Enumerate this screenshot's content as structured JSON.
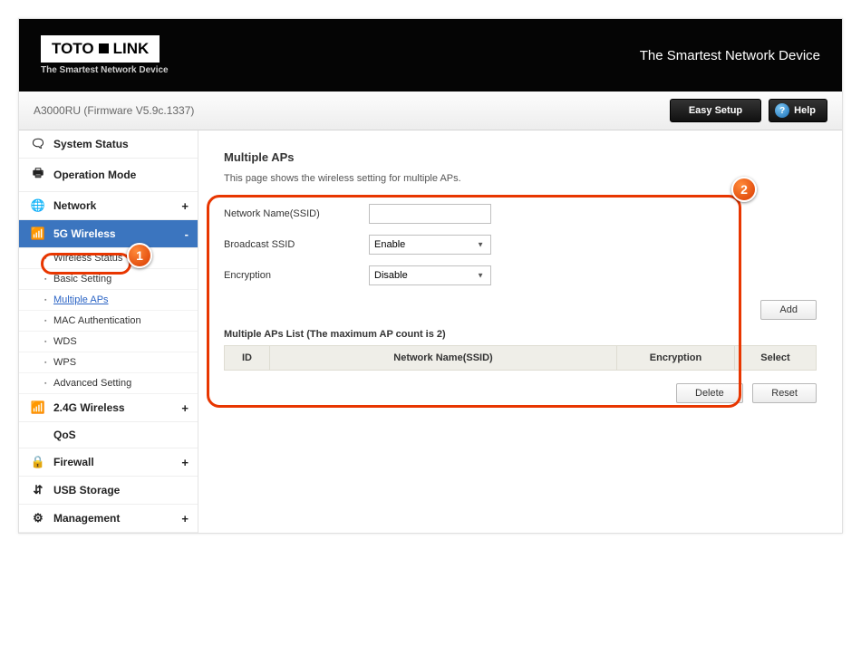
{
  "header": {
    "logo_text1": "TOTO",
    "logo_text2": "LINK",
    "tagline_small": "The Smartest Network Device",
    "tagline_big": "The Smartest Network Device"
  },
  "subheader": {
    "model": "A3000RU (Firmware V5.9c.1337)",
    "easy_setup": "Easy Setup",
    "help": "Help",
    "help_icon_glyph": "?"
  },
  "sidebar": {
    "items": [
      {
        "label": "System Status",
        "icon": "🗨",
        "toggle": ""
      },
      {
        "label": "Operation Mode",
        "icon": "🖶",
        "toggle": ""
      },
      {
        "label": "Network",
        "icon": "🌐",
        "toggle": "+"
      },
      {
        "label": "5G Wireless",
        "icon": "📶",
        "toggle": "-",
        "active": true
      },
      {
        "label": "2.4G Wireless",
        "icon": "📶",
        "toggle": "+"
      },
      {
        "label": "QoS",
        "icon": "",
        "toggle": ""
      },
      {
        "label": "Firewall",
        "icon": "🔒",
        "toggle": "+"
      },
      {
        "label": "USB Storage",
        "icon": "⇵",
        "toggle": ""
      },
      {
        "label": "Management",
        "icon": "⚙",
        "toggle": "+"
      }
    ],
    "sub_5g": [
      {
        "label": "Wireless Status"
      },
      {
        "label": "Basic Setting"
      },
      {
        "label": "Multiple APs",
        "highlight": true
      },
      {
        "label": "MAC Authentication"
      },
      {
        "label": "WDS"
      },
      {
        "label": "WPS"
      },
      {
        "label": "Advanced Setting"
      }
    ]
  },
  "main": {
    "title": "Multiple APs",
    "desc": "This page shows the wireless setting for multiple APs.",
    "form": {
      "ssid_label": "Network Name(SSID)",
      "ssid_value": "",
      "broadcast_label": "Broadcast SSID",
      "broadcast_value": "Enable",
      "encryption_label": "Encryption",
      "encryption_value": "Disable"
    },
    "add_label": "Add",
    "list_title": "Multiple APs List (The maximum AP count is 2)",
    "columns": {
      "id": "ID",
      "name": "Network Name(SSID)",
      "enc": "Encryption",
      "sel": "Select"
    },
    "delete_label": "Delete",
    "reset_label": "Reset"
  },
  "annotations": {
    "one": "1",
    "two": "2"
  }
}
